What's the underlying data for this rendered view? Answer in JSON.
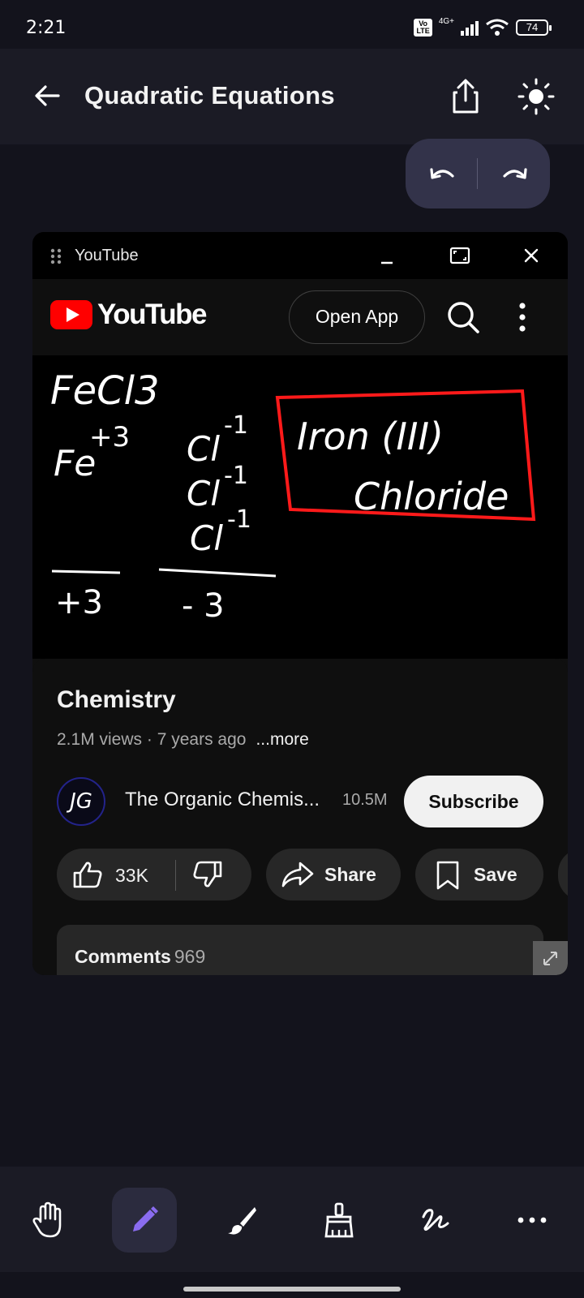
{
  "status_bar": {
    "time": "2:21",
    "volte": "Vo\nLTE",
    "network": "4G+",
    "battery": "74"
  },
  "app_bar": {
    "title": "Quadratic Equations",
    "back_icon": "arrow-left-icon",
    "share_icon": "share-upload-icon",
    "theme_icon": "sun-icon"
  },
  "undo_redo": {
    "undo_icon": "undo-icon",
    "redo_icon": "redo-icon"
  },
  "floating_window": {
    "title": "YouTube",
    "minimize_label": "_",
    "icons": [
      "drag-handle-icon",
      "maximize-icon",
      "close-icon"
    ]
  },
  "youtube": {
    "logo_text": "YouTube",
    "open_app_label": "Open App",
    "video": {
      "title": "Chemistry",
      "views": "2.1M views",
      "age": "7 years ago",
      "more_label": "...more",
      "whiteboard": {
        "formula": "FeCl3",
        "cation": "Fe",
        "cation_charge": "+3",
        "anion": "Cl",
        "anion_charge": "-1",
        "anion_count": 3,
        "cation_total": "+3",
        "anion_total": "- 3",
        "name_line1": "Iron (III)",
        "name_line2": "Chloride"
      }
    },
    "channel": {
      "avatar_text": "JG",
      "name": "The Organic Chemis...",
      "subscribers": "10.5M",
      "subscribe_label": "Subscribe"
    },
    "actions": {
      "likes": "33K",
      "share_label": "Share",
      "save_label": "Save"
    },
    "comments": {
      "label": "Comments",
      "count": "969"
    }
  },
  "toolbar": {
    "tools": [
      "hand-icon",
      "pen-icon",
      "brush-icon",
      "eraser-icon",
      "scribble-icon",
      "more-icon"
    ],
    "active_tool": "pen-icon",
    "active_color": "#8a6cf0"
  }
}
